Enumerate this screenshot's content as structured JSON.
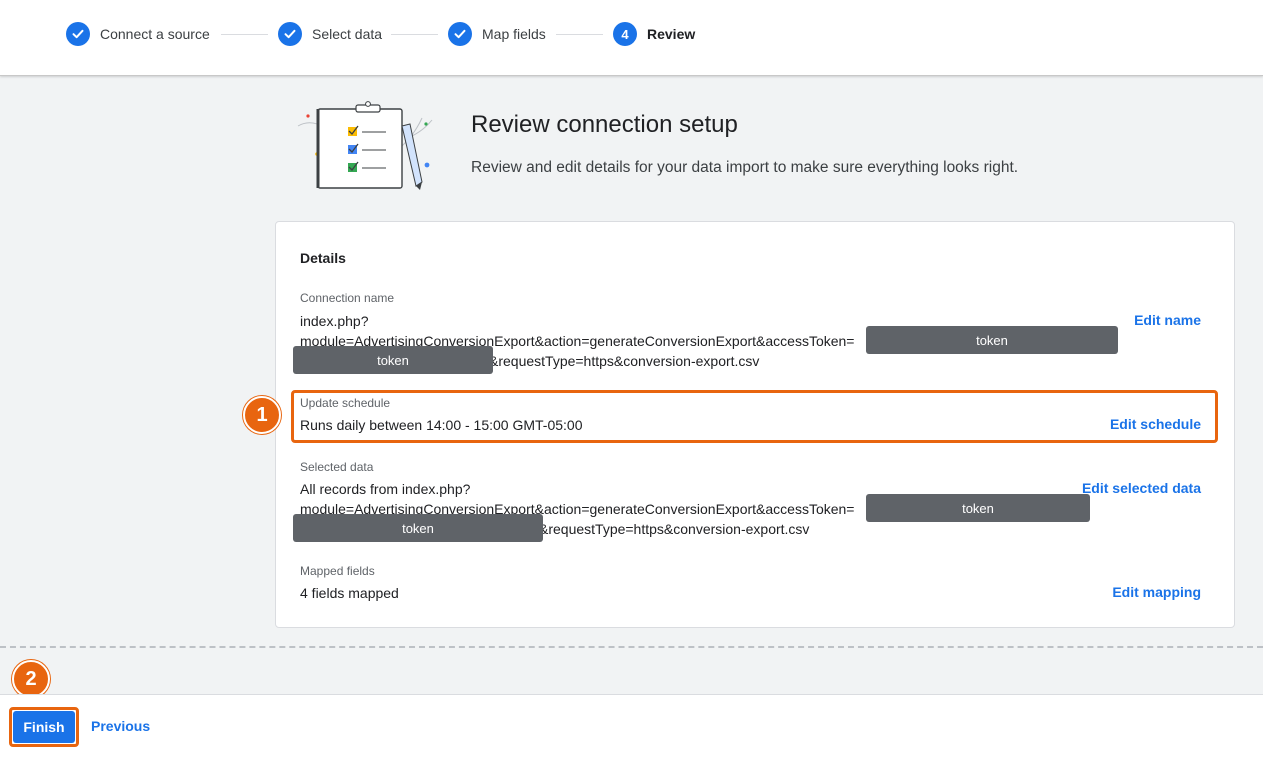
{
  "stepper": {
    "steps": [
      {
        "label": "Connect a source",
        "state": "done"
      },
      {
        "label": "Select data",
        "state": "done"
      },
      {
        "label": "Map fields",
        "state": "done"
      },
      {
        "label": "Review",
        "state": "active",
        "number": "4"
      }
    ]
  },
  "hero": {
    "title": "Review connection setup",
    "description": "Review and edit details for your data import to make sure everything looks right."
  },
  "card": {
    "heading": "Details",
    "connection_name": {
      "label": "Connection name",
      "line1": "index.php?",
      "line2": "module=AdvertisingConversionExport&action=generateConversionExport&accessToken=",
      "line3_suffix": "&requestType=https&conversion-export.csv",
      "redact1": "token",
      "redact2": "token",
      "edit": "Edit name"
    },
    "update_schedule": {
      "label": "Update schedule",
      "value": "Runs daily between 14:00 - 15:00 GMT-05:00",
      "edit": "Edit schedule"
    },
    "selected_data": {
      "label": "Selected data",
      "line1": "All records from index.php?",
      "line2": "module=AdvertisingConversionExport&action=generateConversionExport&accessToken=",
      "line3_suffix": "&requestType=https&conversion-export.csv",
      "redact1": "token",
      "redact2": "token",
      "edit": "Edit selected data"
    },
    "mapped_fields": {
      "label": "Mapped fields",
      "value": "4 fields mapped",
      "edit": "Edit mapping"
    }
  },
  "callouts": {
    "one": "1",
    "two": "2"
  },
  "footer": {
    "finish": "Finish",
    "previous": "Previous"
  },
  "colors": {
    "accent": "#1a73e8",
    "callout": "#e8650f",
    "redaction": "#5f6368"
  }
}
